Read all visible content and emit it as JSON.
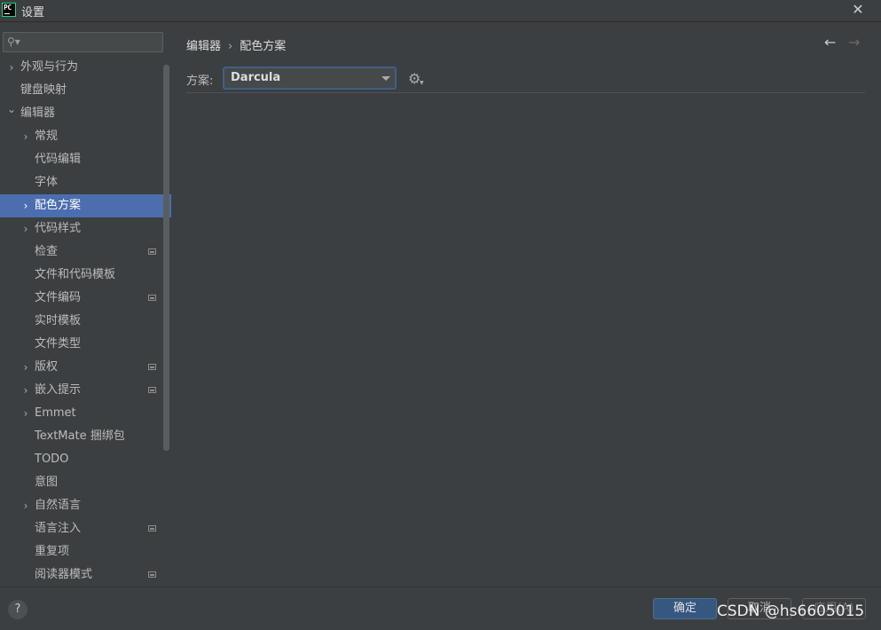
{
  "window": {
    "title": "设置",
    "app_badge": "PC",
    "close_glyph": "✕"
  },
  "search": {
    "placeholder": "",
    "value": ""
  },
  "sidebar": {
    "items": [
      {
        "label": "外观与行为",
        "level": 0,
        "expandable": true,
        "expanded": false,
        "selected": false,
        "project_icon": false
      },
      {
        "label": "键盘映射",
        "level": 0,
        "expandable": false,
        "expanded": false,
        "selected": false,
        "project_icon": false
      },
      {
        "label": "编辑器",
        "level": 0,
        "expandable": true,
        "expanded": true,
        "selected": false,
        "project_icon": false
      },
      {
        "label": "常规",
        "level": 1,
        "expandable": true,
        "expanded": false,
        "selected": false,
        "project_icon": false
      },
      {
        "label": "代码编辑",
        "level": 1,
        "expandable": false,
        "expanded": false,
        "selected": false,
        "project_icon": false
      },
      {
        "label": "字体",
        "level": 1,
        "expandable": false,
        "expanded": false,
        "selected": false,
        "project_icon": false
      },
      {
        "label": "配色方案",
        "level": 1,
        "expandable": true,
        "expanded": false,
        "selected": true,
        "project_icon": false
      },
      {
        "label": "代码样式",
        "level": 1,
        "expandable": true,
        "expanded": false,
        "selected": false,
        "project_icon": false
      },
      {
        "label": "检查",
        "level": 1,
        "expandable": false,
        "expanded": false,
        "selected": false,
        "project_icon": true
      },
      {
        "label": "文件和代码模板",
        "level": 1,
        "expandable": false,
        "expanded": false,
        "selected": false,
        "project_icon": false
      },
      {
        "label": "文件编码",
        "level": 1,
        "expandable": false,
        "expanded": false,
        "selected": false,
        "project_icon": true
      },
      {
        "label": "实时模板",
        "level": 1,
        "expandable": false,
        "expanded": false,
        "selected": false,
        "project_icon": false
      },
      {
        "label": "文件类型",
        "level": 1,
        "expandable": false,
        "expanded": false,
        "selected": false,
        "project_icon": false
      },
      {
        "label": "版权",
        "level": 1,
        "expandable": true,
        "expanded": false,
        "selected": false,
        "project_icon": true
      },
      {
        "label": "嵌入提示",
        "level": 1,
        "expandable": true,
        "expanded": false,
        "selected": false,
        "project_icon": true
      },
      {
        "label": "Emmet",
        "level": 1,
        "expandable": true,
        "expanded": false,
        "selected": false,
        "project_icon": false
      },
      {
        "label": "TextMate 捆绑包",
        "level": 1,
        "expandable": false,
        "expanded": false,
        "selected": false,
        "project_icon": false
      },
      {
        "label": "TODO",
        "level": 1,
        "expandable": false,
        "expanded": false,
        "selected": false,
        "project_icon": false
      },
      {
        "label": "意图",
        "level": 1,
        "expandable": false,
        "expanded": false,
        "selected": false,
        "project_icon": false
      },
      {
        "label": "自然语言",
        "level": 1,
        "expandable": true,
        "expanded": false,
        "selected": false,
        "project_icon": false
      },
      {
        "label": "语言注入",
        "level": 1,
        "expandable": false,
        "expanded": false,
        "selected": false,
        "project_icon": true
      },
      {
        "label": "重复项",
        "level": 1,
        "expandable": false,
        "expanded": false,
        "selected": false,
        "project_icon": false
      },
      {
        "label": "阅读器模式",
        "level": 1,
        "expandable": false,
        "expanded": false,
        "selected": false,
        "project_icon": true
      }
    ]
  },
  "main": {
    "breadcrumb": [
      "编辑器",
      "配色方案"
    ],
    "breadcrumb_sep": "›",
    "scheme_label": "方案:",
    "scheme_value": "Darcula",
    "nav_back": "←",
    "nav_forward": "→"
  },
  "footer": {
    "help": "?",
    "ok": "确定",
    "cancel": "取消",
    "apply": "应用(A)",
    "watermark": "CSDN @hs6605015"
  },
  "colors": {
    "background": "#3c3f41",
    "selection": "#4b6eaf",
    "ok_button": "#365880",
    "app_badge_border": "#21d789"
  }
}
